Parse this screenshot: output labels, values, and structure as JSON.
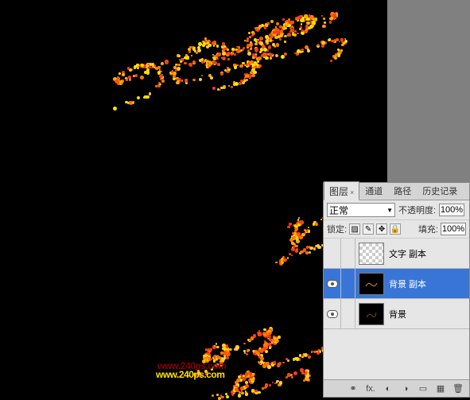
{
  "watermark": {
    "text": "www.240ps.com"
  },
  "panel": {
    "tabs": {
      "layers": "图层",
      "channels": "通道",
      "paths": "路径",
      "history": "历史记录"
    },
    "blend_mode": "正常",
    "opacity_label": "不透明度:",
    "opacity_value": "100%",
    "lock_label": "锁定:",
    "fill_label": "填充:",
    "fill_value": "100%",
    "layers": [
      {
        "name": "文字 副本",
        "visible": false,
        "selected": false,
        "thumb": "checker"
      },
      {
        "name": "背景 副本",
        "visible": true,
        "selected": true,
        "thumb": "dark-art"
      },
      {
        "name": "背景",
        "visible": true,
        "selected": false,
        "thumb": "dark-art2"
      }
    ],
    "footer_icons": {
      "link": "⚭",
      "fx": "fx.",
      "mask": "◐",
      "adjust": "◑",
      "folder": "▭",
      "new": "▦",
      "trash": "🗑"
    }
  }
}
